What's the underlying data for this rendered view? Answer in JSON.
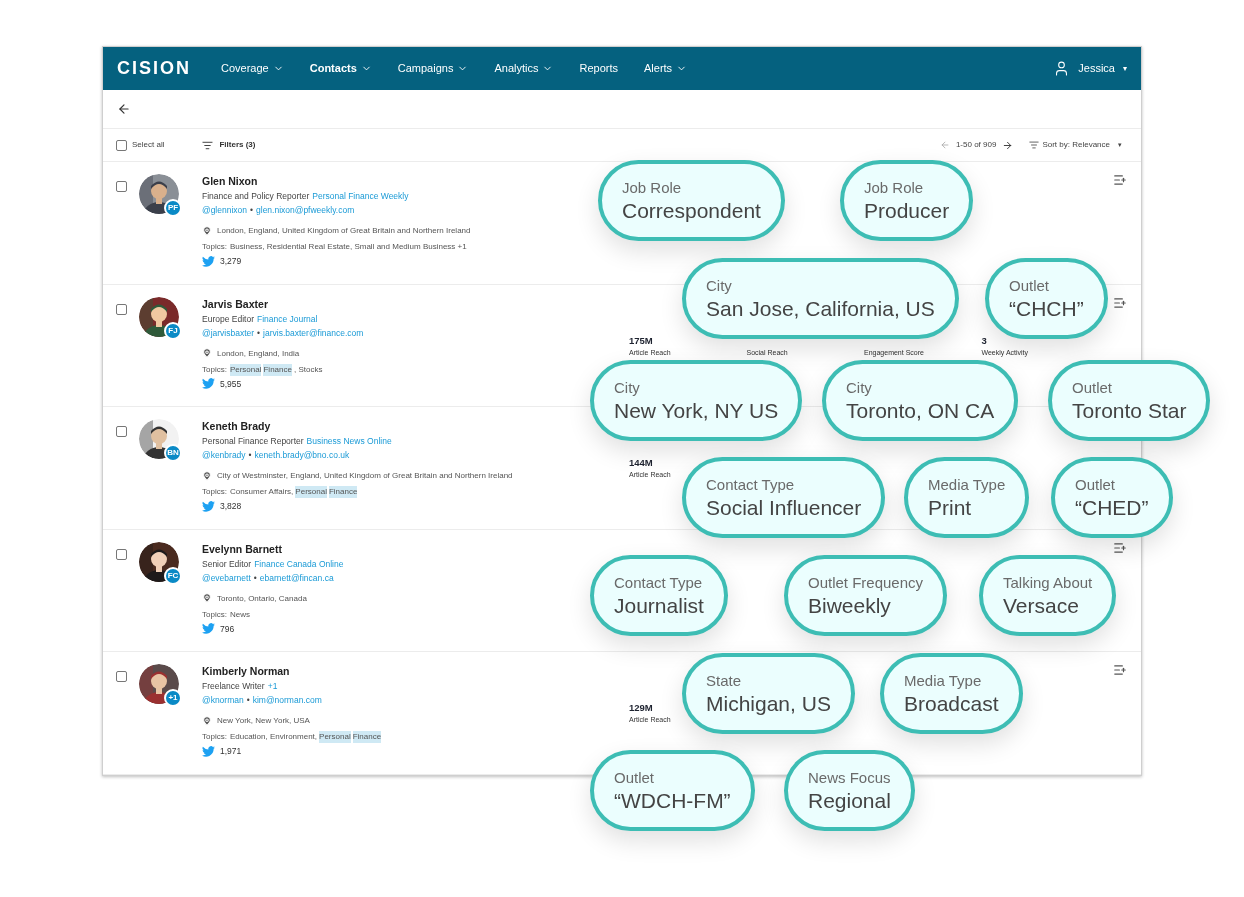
{
  "nav": {
    "logo": "CISION",
    "items": [
      {
        "label": "Coverage",
        "selected": false
      },
      {
        "label": "Contacts",
        "selected": true
      },
      {
        "label": "Campaigns",
        "selected": false
      },
      {
        "label": "Analytics",
        "selected": false
      },
      {
        "label": "Reports",
        "selected": false,
        "menu": false
      },
      {
        "label": "Alerts",
        "selected": false
      }
    ],
    "user": "Jessica",
    "user_caret": "▾"
  },
  "toolbar": {
    "select_all": {
      "label": "Select all",
      "checked": false
    },
    "filters": "Filters (3)",
    "pagination": "1-50 of 909",
    "sort": "Sort by: Relevance",
    "sort_caret": "▾"
  },
  "contacts": [
    {
      "name": "Glen Nixon",
      "badge": "PF",
      "role": "Finance and Policy Reporter",
      "outlet": "Personal Finance Weekly",
      "handle": "@glennixon",
      "separator": "•",
      "email": "glen.nixon@pfweekly.com",
      "location": "London, England, United Kingdom of Great Britain and Northern Ireland",
      "topics_label": "Topics:",
      "topics": [
        {
          "text": "Business, Residential Real Estate, Small and Medium Business +1",
          "highlighted": false
        }
      ],
      "followers": "3,279",
      "checked": false,
      "list_icon": true
    },
    {
      "name": "Jarvis Baxter",
      "badge": "FJ",
      "role": "Europe Editor",
      "outlet": "Finance Journal",
      "handle": "@jarvisbaxter",
      "separator": "•",
      "email": "jarvis.baxter@finance.com",
      "location": "London, England, India",
      "topics_label": "Topics:",
      "topics": [
        {
          "text": "Personal",
          "highlighted": true
        },
        {
          "text": "Finance",
          "highlighted": true
        },
        {
          "text": ", Stocks",
          "highlighted": false
        }
      ],
      "followers": "5,955",
      "checked": false,
      "list_icon": true,
      "metrics": [
        {
          "value": "175M",
          "label": "Article Reach"
        },
        {
          "label": "Social Reach"
        },
        {
          "label": "Engagement Score"
        },
        {
          "value": "3",
          "label": "Weekly Activity"
        }
      ]
    },
    {
      "name": "Keneth Brady",
      "badge": "BN",
      "role": "Personal Finance Reporter",
      "outlet": "Business News Online",
      "handle": "@kenbrady",
      "separator": "•",
      "email": "keneth.brady@bno.co.uk",
      "location": "City of Westminster, England, United Kingdom of Great Britain and Northern Ireland",
      "topics_label": "Topics:",
      "topics": [
        {
          "text": "Consumer Affairs,",
          "highlighted": false
        },
        {
          "text": "Personal",
          "highlighted": true
        },
        {
          "text": "Finance",
          "highlighted": true
        }
      ],
      "followers": "3,828",
      "checked": false,
      "metrics": [
        {
          "value": "144M",
          "label": "Article Reach"
        }
      ]
    },
    {
      "name": "Evelynn Barnett",
      "badge": "FC",
      "role": "Senior Editor",
      "outlet": "Finance Canada Online",
      "handle": "@evebarnett",
      "separator": "•",
      "email": "ebarnett@fincan.ca",
      "location": "Toronto, Ontario, Canada",
      "topics_label": "Topics:",
      "topics": [
        {
          "text": "News",
          "highlighted": false
        }
      ],
      "followers": "796",
      "checked": false,
      "list_icon": true
    },
    {
      "name": "Kimberly Norman",
      "badge": "+1",
      "role": "Freelance Writer",
      "outlet": "+1",
      "handle": "@knorman",
      "separator": "•",
      "email": "kim@norman.com",
      "location": "New York, New York, USA",
      "topics_label": "Topics:",
      "topics": [
        {
          "text": "Education, Environment,",
          "highlighted": false
        },
        {
          "text": "Personal",
          "highlighted": true
        },
        {
          "text": "Finance",
          "highlighted": true
        }
      ],
      "followers": "1,971",
      "checked": false,
      "list_icon": true,
      "metrics": [
        {
          "value": "129M",
          "label": "Article Reach"
        }
      ]
    }
  ],
  "filter_pills": [
    {
      "label": "Job Role",
      "value": "Correspondent"
    },
    {
      "label": "Job Role",
      "value": "Producer"
    },
    {
      "label": "City",
      "value": "San Jose, California, US"
    },
    {
      "label": "Outlet",
      "value": "“CHCH”"
    },
    {
      "label": "City",
      "value": "New York, NY US"
    },
    {
      "label": "City",
      "value": "Toronto, ON CA"
    },
    {
      "label": "Outlet",
      "value": "Toronto Star"
    },
    {
      "label": "Contact Type",
      "value": "Social Influencer"
    },
    {
      "label": "Media Type",
      "value": "Print"
    },
    {
      "label": "Outlet",
      "value": "“CHED”"
    },
    {
      "label": "Contact Type",
      "value": "Journalist"
    },
    {
      "label": "Outlet Frequency",
      "value": "Biweekly"
    },
    {
      "label": "Talking About",
      "value": "Versace"
    },
    {
      "label": "State",
      "value": "Michigan, US"
    },
    {
      "label": "Media Type",
      "value": "Broadcast"
    },
    {
      "label": "Outlet",
      "value": "“WDCH-FM”"
    },
    {
      "label": "News Focus",
      "value": "Regional"
    }
  ]
}
